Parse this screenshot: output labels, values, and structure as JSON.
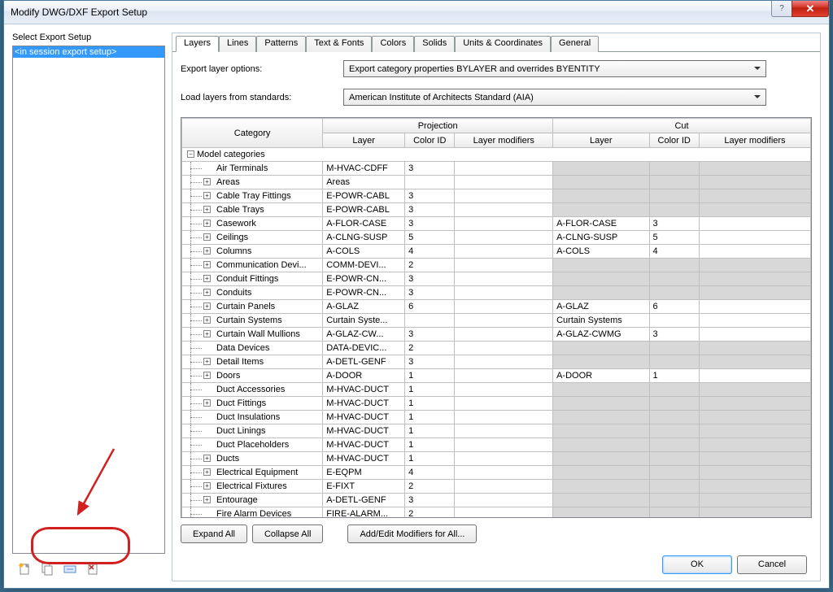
{
  "window": {
    "title": "Modify DWG/DXF Export Setup"
  },
  "left": {
    "label": "Select Export Setup",
    "items": [
      "<in session export setup>"
    ]
  },
  "toolbar": {
    "icons": [
      "new-setup-icon",
      "duplicate-setup-icon",
      "rename-setup-icon",
      "delete-setup-icon"
    ]
  },
  "tabs": [
    "Layers",
    "Lines",
    "Patterns",
    "Text & Fonts",
    "Colors",
    "Solids",
    "Units & Coordinates",
    "General"
  ],
  "active_tab": 0,
  "options": {
    "export_layer_label": "Export layer options:",
    "export_layer_value": "Export category properties BYLAYER and overrides BYENTITY",
    "load_layers_label": "Load layers from standards:",
    "load_layers_value": "American Institute of Architects Standard (AIA)"
  },
  "table": {
    "headers_top": [
      "Category",
      "Projection",
      "Cut"
    ],
    "headers": [
      "Layer",
      "Color ID",
      "Layer modifiers",
      "Layer",
      "Color ID",
      "Layer modifiers"
    ],
    "root": "Model categories",
    "rows": [
      {
        "cat": "Air Terminals",
        "pl": "M-HVAC-CDFF",
        "pc": "3",
        "pm": "",
        "cl": "",
        "cc": "",
        "cm": "",
        "grey": true,
        "exp": false
      },
      {
        "cat": "Areas",
        "pl": "Areas",
        "pc": "",
        "pm": "",
        "cl": "",
        "cc": "",
        "cm": "",
        "grey": true,
        "exp": true
      },
      {
        "cat": "Cable Tray Fittings",
        "pl": "E-POWR-CABL",
        "pc": "3",
        "pm": "",
        "cl": "",
        "cc": "",
        "cm": "",
        "grey": true,
        "exp": true
      },
      {
        "cat": "Cable Trays",
        "pl": "E-POWR-CABL",
        "pc": "3",
        "pm": "",
        "cl": "",
        "cc": "",
        "cm": "",
        "grey": true,
        "exp": true
      },
      {
        "cat": "Casework",
        "pl": "A-FLOR-CASE",
        "pc": "3",
        "pm": "",
        "cl": "A-FLOR-CASE",
        "cc": "3",
        "cm": "",
        "grey": false,
        "exp": true
      },
      {
        "cat": "Ceilings",
        "pl": "A-CLNG-SUSP",
        "pc": "5",
        "pm": "",
        "cl": "A-CLNG-SUSP",
        "cc": "5",
        "cm": "",
        "grey": false,
        "exp": true
      },
      {
        "cat": "Columns",
        "pl": "A-COLS",
        "pc": "4",
        "pm": "",
        "cl": "A-COLS",
        "cc": "4",
        "cm": "",
        "grey": false,
        "exp": true
      },
      {
        "cat": "Communication Devi...",
        "pl": "COMM-DEVI...",
        "pc": "2",
        "pm": "",
        "cl": "",
        "cc": "",
        "cm": "",
        "grey": true,
        "exp": true
      },
      {
        "cat": "Conduit Fittings",
        "pl": "E-POWR-CN...",
        "pc": "3",
        "pm": "",
        "cl": "",
        "cc": "",
        "cm": "",
        "grey": true,
        "exp": true
      },
      {
        "cat": "Conduits",
        "pl": "E-POWR-CN...",
        "pc": "3",
        "pm": "",
        "cl": "",
        "cc": "",
        "cm": "",
        "grey": true,
        "exp": true
      },
      {
        "cat": "Curtain Panels",
        "pl": "A-GLAZ",
        "pc": "6",
        "pm": "",
        "cl": "A-GLAZ",
        "cc": "6",
        "cm": "",
        "grey": false,
        "exp": true
      },
      {
        "cat": "Curtain Systems",
        "pl": "Curtain Syste...",
        "pc": "",
        "pm": "",
        "cl": "Curtain Systems",
        "cc": "",
        "cm": "",
        "grey": false,
        "exp": true
      },
      {
        "cat": "Curtain Wall Mullions",
        "pl": "A-GLAZ-CW...",
        "pc": "3",
        "pm": "",
        "cl": "A-GLAZ-CWMG",
        "cc": "3",
        "cm": "",
        "grey": false,
        "exp": true
      },
      {
        "cat": "Data Devices",
        "pl": "DATA-DEVIC...",
        "pc": "2",
        "pm": "",
        "cl": "",
        "cc": "",
        "cm": "",
        "grey": true,
        "exp": false
      },
      {
        "cat": "Detail Items",
        "pl": "A-DETL-GENF",
        "pc": "3",
        "pm": "",
        "cl": "",
        "cc": "",
        "cm": "",
        "grey": true,
        "exp": true
      },
      {
        "cat": "Doors",
        "pl": "A-DOOR",
        "pc": "1",
        "pm": "",
        "cl": "A-DOOR",
        "cc": "1",
        "cm": "",
        "grey": false,
        "exp": true
      },
      {
        "cat": "Duct Accessories",
        "pl": "M-HVAC-DUCT",
        "pc": "1",
        "pm": "",
        "cl": "",
        "cc": "",
        "cm": "",
        "grey": true,
        "exp": false
      },
      {
        "cat": "Duct Fittings",
        "pl": "M-HVAC-DUCT",
        "pc": "1",
        "pm": "",
        "cl": "",
        "cc": "",
        "cm": "",
        "grey": true,
        "exp": true
      },
      {
        "cat": "Duct Insulations",
        "pl": "M-HVAC-DUCT",
        "pc": "1",
        "pm": "",
        "cl": "",
        "cc": "",
        "cm": "",
        "grey": true,
        "exp": false
      },
      {
        "cat": "Duct Linings",
        "pl": "M-HVAC-DUCT",
        "pc": "1",
        "pm": "",
        "cl": "",
        "cc": "",
        "cm": "",
        "grey": true,
        "exp": false
      },
      {
        "cat": "Duct Placeholders",
        "pl": "M-HVAC-DUCT",
        "pc": "1",
        "pm": "",
        "cl": "",
        "cc": "",
        "cm": "",
        "grey": true,
        "exp": false
      },
      {
        "cat": "Ducts",
        "pl": "M-HVAC-DUCT",
        "pc": "1",
        "pm": "",
        "cl": "",
        "cc": "",
        "cm": "",
        "grey": true,
        "exp": true
      },
      {
        "cat": "Electrical Equipment",
        "pl": "E-EQPM",
        "pc": "4",
        "pm": "",
        "cl": "",
        "cc": "",
        "cm": "",
        "grey": true,
        "exp": true
      },
      {
        "cat": "Electrical Fixtures",
        "pl": "E-FIXT",
        "pc": "2",
        "pm": "",
        "cl": "",
        "cc": "",
        "cm": "",
        "grey": true,
        "exp": true
      },
      {
        "cat": "Entourage",
        "pl": "A-DETL-GENF",
        "pc": "3",
        "pm": "",
        "cl": "",
        "cc": "",
        "cm": "",
        "grey": true,
        "exp": true
      },
      {
        "cat": "Fire Alarm Devices",
        "pl": "FIRE-ALARM...",
        "pc": "2",
        "pm": "",
        "cl": "",
        "cc": "",
        "cm": "",
        "grey": true,
        "exp": false
      }
    ]
  },
  "buttons": {
    "expand_all": "Expand All",
    "collapse_all": "Collapse All",
    "add_edit_modifiers": "Add/Edit Modifiers for All...",
    "ok": "OK",
    "cancel": "Cancel"
  }
}
